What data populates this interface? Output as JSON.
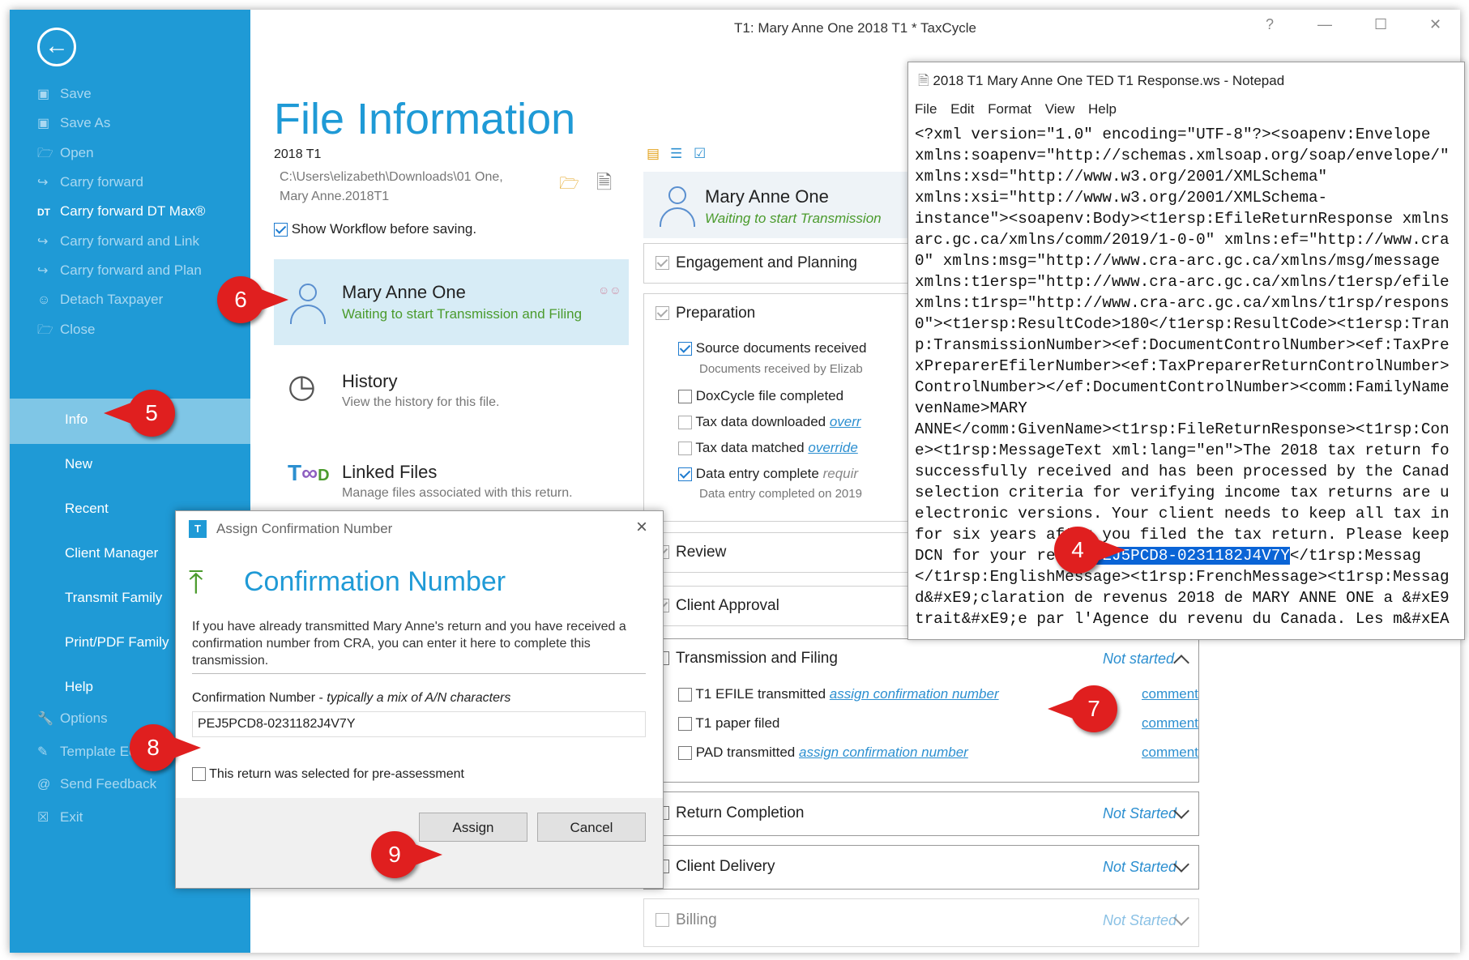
{
  "window": {
    "title": "T1: Mary Anne One 2018 T1 * TaxCycle",
    "help": "?",
    "minimize": "—",
    "maximize": "☐",
    "close": "✕"
  },
  "sidebar": {
    "items": [
      {
        "label": "Save",
        "icon": "save-icon"
      },
      {
        "label": "Save As",
        "icon": "save-as-icon"
      },
      {
        "label": "Open",
        "icon": "open-icon"
      },
      {
        "label": "Carry forward",
        "icon": "carry-forward-icon"
      },
      {
        "label": "Carry forward DT Max®",
        "icon": "dt-max-icon"
      },
      {
        "label": "Carry forward and Link",
        "icon": "carry-forward-link-icon"
      },
      {
        "label": "Carry forward and Plan",
        "icon": "carry-forward-plan-icon"
      },
      {
        "label": "Detach Taxpayer",
        "icon": "detach-icon"
      },
      {
        "label": "Close",
        "icon": "close-folder-icon"
      }
    ],
    "big_items": [
      "Info",
      "New",
      "Recent",
      "Client Manager",
      "Transmit Family",
      "Print/PDF Family",
      "Help"
    ],
    "bottom_items": [
      {
        "label": "Options",
        "icon": "wrench-icon"
      },
      {
        "label": "Template Editor",
        "icon": "template-icon"
      },
      {
        "label": "Send Feedback",
        "icon": "at-icon"
      },
      {
        "label": "Exit",
        "icon": "exit-icon"
      }
    ]
  },
  "file_info": {
    "title": "File Information",
    "year": "2018 T1",
    "path_line1": "C:\\Users\\elizabeth\\Downloads\\01 One,",
    "path_line2": "Mary Anne.2018T1",
    "show_workflow": "Show Workflow before saving.",
    "client_name": "Mary Anne One",
    "client_status": "Waiting to start Transmission and Filing",
    "history_title": "History",
    "history_desc": "View the history for this file.",
    "linked_title": "Linked Files",
    "linked_desc": "Manage files associated with this return."
  },
  "workflow": {
    "client_name": "Mary Anne One",
    "client_status": "Waiting to start Transmission",
    "engagement": "Engagement and Planning",
    "preparation": "Preparation",
    "prep_items": [
      {
        "label": "Source documents received",
        "sub": "Documents received by Elizab"
      },
      {
        "label": "DoxCycle file completed"
      },
      {
        "label": "Tax data downloaded",
        "link": "overr"
      },
      {
        "label": "Tax data matched",
        "link": "override"
      },
      {
        "label": "Data entry complete",
        "link": "requir",
        "sub": "Data entry completed on 2019"
      }
    ],
    "review": "Review",
    "client_approval": "Client Approval",
    "transmission": "Transmission and Filing",
    "not_started": "Not started",
    "not_started_cap": "Not Started",
    "trans_items": [
      {
        "label": "T1 EFILE transmitted",
        "link": "assign confirmation number",
        "comment": "comment"
      },
      {
        "label": "T1 paper filed",
        "comment": "comment"
      },
      {
        "label": "PAD transmitted",
        "link": "assign confirmation number",
        "comment": "comment"
      }
    ],
    "return_completion": "Return Completion",
    "client_delivery": "Client Delivery",
    "billing": "Billing"
  },
  "notepad": {
    "title": "2018 T1 Mary Anne One TED T1 Response.ws - Notepad",
    "menu": [
      "File",
      "Edit",
      "Format",
      "View",
      "Help"
    ],
    "lines": [
      "<?xml version=\"1.0\" encoding=\"UTF-8\"?><soapenv:Envelope",
      "xmlns:soapenv=\"http://schemas.xmlsoap.org/soap/envelope/\"",
      "xmlns:xsd=\"http://www.w3.org/2001/XMLSchema\"",
      "xmlns:xsi=\"http://www.w3.org/2001/XMLSchema-",
      "instance\"><soapenv:Body><t1ersp:EfileReturnResponse xmlns",
      "arc.gc.ca/xmlns/comm/2019/1-0-0\" xmlns:ef=\"http://www.cra",
      "0\" xmlns:msg=\"http://www.cra-arc.gc.ca/xmlns/msg/message",
      "xmlns:t1ersp=\"http://www.cra-arc.gc.ca/xmlns/t1ersp/efile",
      "xmlns:t1rsp=\"http://www.cra-arc.gc.ca/xmlns/t1rsp/respons",
      "0\"><t1ersp:ResultCode>180</t1ersp:ResultCode><t1ersp:Tran",
      "p:TransmissionNumber><ef:DocumentControlNumber><ef:TaxPre",
      "xPreparerEfilerNumber><ef:TaxPreparerReturnControlNumber>",
      "ControlNumber></ef:DocumentControlNumber><comm:FamilyName",
      "venName>MARY",
      "ANNE</comm:GivenName><t1rsp:FileReturnResponse><t1rsp:Con",
      "e><t1rsp:MessageText xml:lang=\"en\">The 2018 tax return fo",
      "successfully received and has been processed by the Canad",
      "selection criteria for verifying income tax returns are u",
      "electronic versions. Your client needs to keep all tax in",
      "for six years after you filed the tax return. Please keep"
    ],
    "dcn_prefix": "DCN for your re",
    "dcn_gap": "    ",
    "dcn_value": "PEJ5PCD8-0231182J4V7Y",
    "dcn_suffix": "</t1rsp:Messag",
    "lines_after": [
      "</t1rsp:EnglishMessage><t1rsp:FrenchMessage><t1rsp:Messag",
      "d&#xE9;claration de revenus 2018 de MARY ANNE ONE a &#xE9",
      "trait&#xE9;e par l'Agence du revenu du Canada. Les m&#xEA"
    ]
  },
  "dialog": {
    "title": "Assign Confirmation Number",
    "heading": "Confirmation Number",
    "description": "If you have already transmitted Mary Anne's return and you have received a confirmation number from CRA, you can enter it here to complete this transmission.",
    "field_label": "Confirmation Number - ",
    "field_hint": "typically a mix of A/N characters",
    "field_value": "PEJ5PCD8-0231182J4V7Y",
    "preassessment": "This return was selected for pre-assessment",
    "assign": "Assign",
    "cancel": "Cancel"
  },
  "callouts": [
    "4",
    "5",
    "6",
    "7",
    "8",
    "9"
  ]
}
